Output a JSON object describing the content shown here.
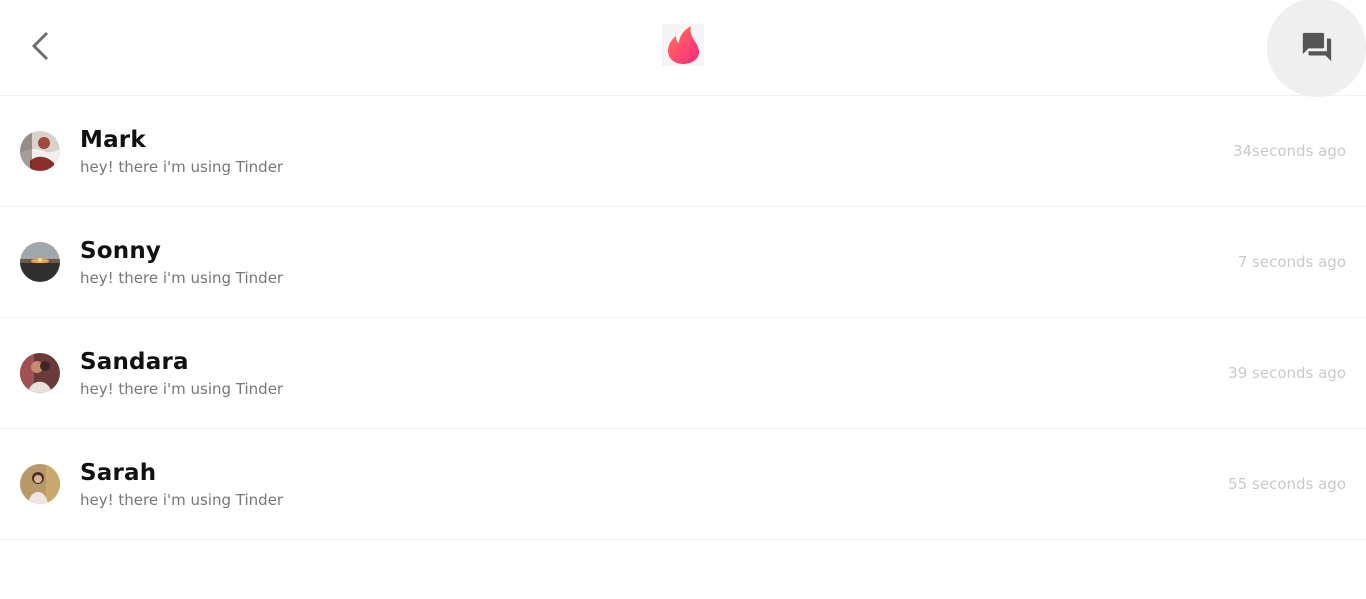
{
  "header": {
    "back_icon": "chevron-left-icon",
    "logo_icon": "tinder-flame-icon",
    "chat_icon": "forum-icon",
    "brand_color": "#fd5068"
  },
  "conversations": [
    {
      "name": "Mark",
      "message": "hey! there i'm using Tinder",
      "time": "34seconds ago"
    },
    {
      "name": "Sonny",
      "message": "hey! there i'm using Tinder",
      "time": "7 seconds ago"
    },
    {
      "name": "Sandara",
      "message": "hey! there i'm using Tinder",
      "time": "39 seconds ago"
    },
    {
      "name": "Sarah",
      "message": "hey! there i'm using Tinder",
      "time": "55 seconds ago"
    }
  ]
}
